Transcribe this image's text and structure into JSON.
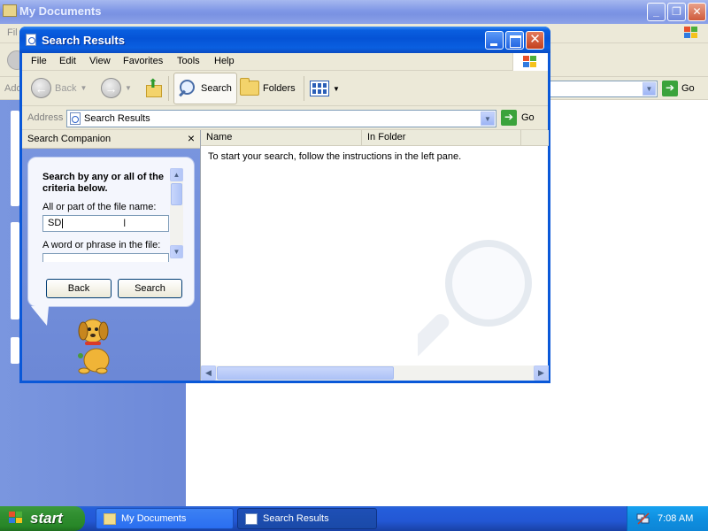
{
  "background_window": {
    "title": "My Documents",
    "menu_stub": "Fil",
    "address_stub": "Add",
    "go_label": "Go",
    "title_buttons": [
      "_",
      "❐",
      "✕"
    ]
  },
  "search_window": {
    "title": "Search Results",
    "menu": [
      "File",
      "Edit",
      "View",
      "Favorites",
      "Tools",
      "Help"
    ],
    "toolbar": {
      "back": "Back",
      "search": "Search",
      "folders": "Folders"
    },
    "address": {
      "label": "Address",
      "value": "Search Results",
      "go": "Go"
    },
    "companion": {
      "title": "Search Companion",
      "close": "×",
      "heading": "Search by any or all of the criteria below.",
      "filename_label": "All or part of the file name:",
      "filename_value": "SD",
      "phrase_label": "A word or phrase in the file:",
      "phrase_value": "",
      "back_button": "Back",
      "search_button": "Search"
    },
    "results": {
      "columns": [
        "Name",
        "In Folder"
      ],
      "hint": "To start your search, follow the instructions in the left pane."
    }
  },
  "taskbar": {
    "start": "start",
    "tasks": [
      {
        "label": "My Documents",
        "active": false
      },
      {
        "label": "Search Results",
        "active": true
      }
    ],
    "clock": "7:08 AM"
  },
  "colors": {
    "xp_blue": "#0a58d8",
    "start_green": "#2f8d2f",
    "tray_blue": "#0f8fe0"
  }
}
